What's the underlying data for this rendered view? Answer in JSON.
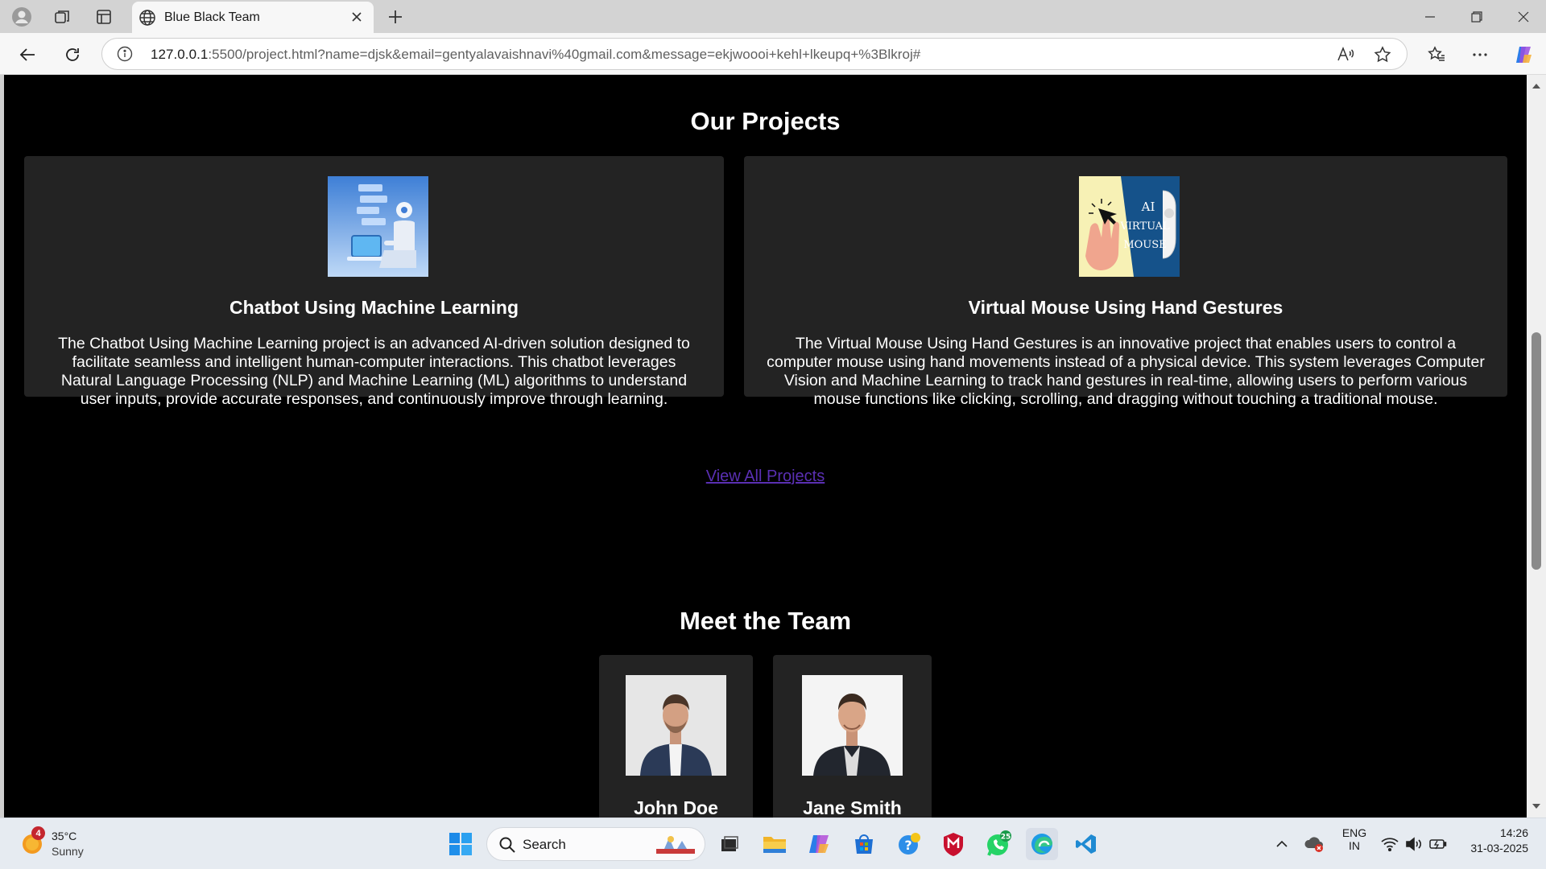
{
  "browser": {
    "tab_title": "Blue Black Team",
    "url_host": "127.0.0.1",
    "url_rest": ":5500/project.html?name=djsk&email=gentyalavaishnavi%40gmail.com&message=ekjwoooi+kehl+lkeupq+%3Blkroj#"
  },
  "projects": {
    "heading": "Our Projects",
    "items": [
      {
        "title": "Chatbot Using Machine Learning",
        "description": "The Chatbot Using Machine Learning project is an advanced AI-driven solution designed to facilitate seamless and intelligent human-computer interactions. This chatbot leverages Natural Language Processing (NLP) and Machine Learning (ML) algorithms to understand user inputs, provide accurate responses, and continuously improve through learning."
      },
      {
        "title": "Virtual Mouse Using Hand Gestures",
        "description": "The Virtual Mouse Using Hand Gestures is an innovative project that enables users to control a computer mouse using hand movements instead of a physical device. This system leverages Computer Vision and Machine Learning to track hand gestures in real-time, allowing users to perform various mouse functions like clicking, scrolling, and dragging without touching a traditional mouse.",
        "image_text": [
          "AI",
          "VIRTUAL",
          "MOUSE"
        ]
      }
    ],
    "view_all": "View All Projects"
  },
  "team": {
    "heading": "Meet the Team",
    "members": [
      {
        "name": "John Doe"
      },
      {
        "name": "Jane Smith"
      }
    ]
  },
  "taskbar": {
    "weather_temp": "35°C",
    "weather_cond": "Sunny",
    "weather_badge": "4",
    "search_label": "Search",
    "whatsapp_badge": "25",
    "lang": "ENG",
    "region": "IN",
    "time": "14:26",
    "date": "31-03-2025"
  },
  "colors": {
    "page_bg": "#000000",
    "card_bg": "#232323",
    "link": "#5a2fb3"
  }
}
